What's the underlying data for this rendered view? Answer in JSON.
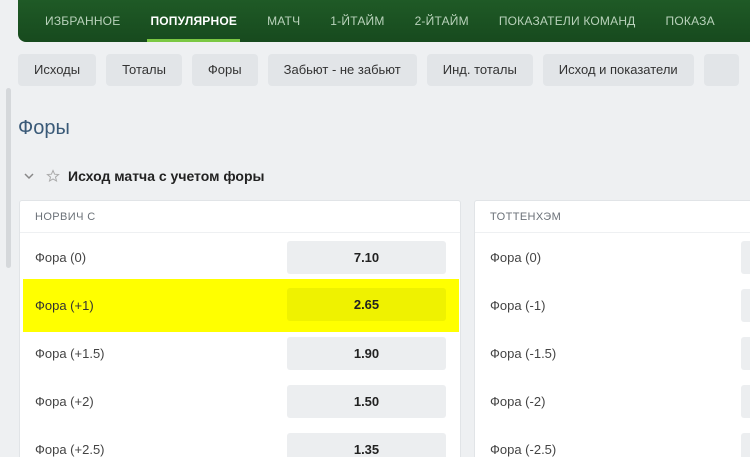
{
  "top_tabs": [
    {
      "label": "ИЗБРАННОЕ",
      "active": false
    },
    {
      "label": "ПОПУЛЯРНОЕ",
      "active": true
    },
    {
      "label": "МАТЧ",
      "active": false
    },
    {
      "label": "1-ЙТАЙМ",
      "active": false
    },
    {
      "label": "2-ЙТАЙМ",
      "active": false
    },
    {
      "label": "ПОКАЗАТЕЛИ КОМАНД",
      "active": false
    },
    {
      "label": "ПОКАЗА",
      "active": false
    }
  ],
  "filters": [
    "Исходы",
    "Тоталы",
    "Форы",
    "Забьют - не забьют",
    "Инд. тоталы",
    "Исход и показатели"
  ],
  "page_title": "Форы",
  "section": {
    "title": "Исход матча с учетом форы"
  },
  "teams": {
    "left": "НОРВИЧ С",
    "right": "ТОТТЕНХЭМ"
  },
  "left_rows": [
    {
      "label": "Фора (0)",
      "odds": "7.10"
    },
    {
      "label": "Фора (+1)",
      "odds": "2.65",
      "highlighted": true
    },
    {
      "label": "Фора (+1.5)",
      "odds": "1.90"
    },
    {
      "label": "Фора (+2)",
      "odds": "1.50"
    },
    {
      "label": "Фора (+2.5)",
      "odds": "1.35"
    }
  ],
  "right_rows": [
    {
      "label": "Фора (0)"
    },
    {
      "label": "Фора (-1)"
    },
    {
      "label": "Фора (-1.5)"
    },
    {
      "label": "Фора (-2)"
    },
    {
      "label": "Фора (-2.5)"
    }
  ],
  "colors": {
    "nav_bg": "#1b5221",
    "nav_active_underline": "#7bc843",
    "highlight": "#ffff00",
    "title": "#3a5a78"
  }
}
